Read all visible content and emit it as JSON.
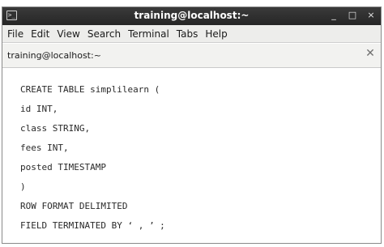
{
  "window": {
    "title": "training@localhost:~",
    "icon": "terminal-icon",
    "controls": [
      "_",
      "□",
      "×"
    ]
  },
  "menubar": {
    "items": [
      "File",
      "Edit",
      "View",
      "Search",
      "Terminal",
      "Tabs",
      "Help"
    ]
  },
  "tab": {
    "label": "training@localhost:~",
    "close_icon": "close-icon"
  },
  "terminal": {
    "lines": [
      "CREATE TABLE simplilearn (",
      "id INT,",
      "class STRING,",
      "fees INT,",
      "posted TIMESTAMP",
      ")",
      "ROW FORMAT DELIMITED",
      "FIELD TERMINATED BY ‘ , ’ ;"
    ]
  }
}
